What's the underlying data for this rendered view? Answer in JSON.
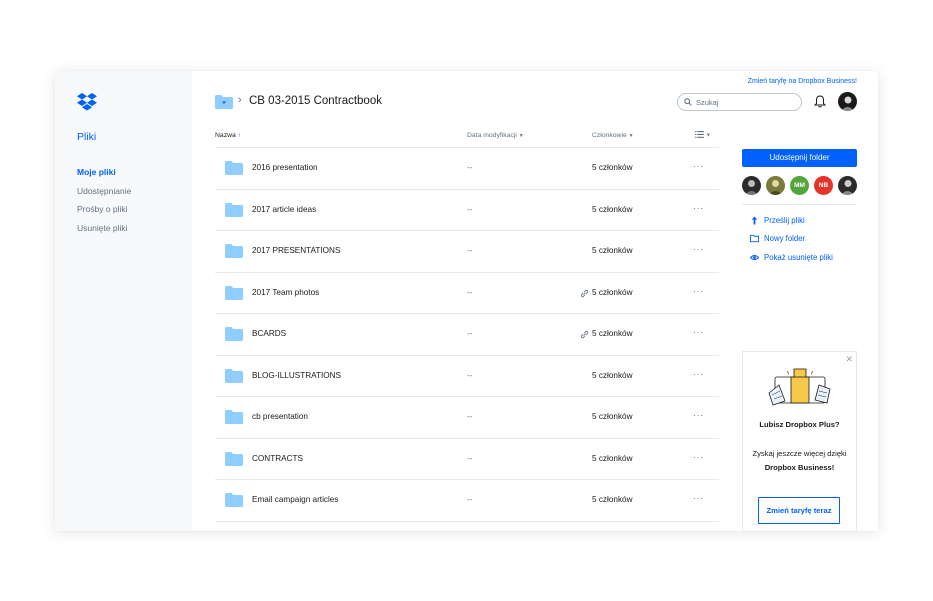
{
  "header": {
    "upgrade_link": "Zmień taryfę na Dropbox Business!",
    "title": "CB 03-2015 Contractbook",
    "search_placeholder": "Szukaj"
  },
  "sidebar": {
    "title": "Pliki",
    "items": [
      {
        "label": "Moje pliki",
        "active": true
      },
      {
        "label": "Udostępnianie"
      },
      {
        "label": "Prośby o pliki"
      },
      {
        "label": "Usunięte pliki"
      }
    ]
  },
  "table": {
    "columns": {
      "name": "Nazwa",
      "date": "Data modyfikacji",
      "members": "Członkowie"
    },
    "rows": [
      {
        "name": "2016 presentation",
        "date": "--",
        "members": "5 członków",
        "link": false
      },
      {
        "name": "2017 article ideas",
        "date": "--",
        "members": "5 członków",
        "link": false
      },
      {
        "name": "2017 PRESENTATIONS",
        "date": "--",
        "members": "5 członków",
        "link": false
      },
      {
        "name": "2017 Team photos",
        "date": "--",
        "members": "5 członków",
        "link": true
      },
      {
        "name": "BCARDS",
        "date": "--",
        "members": "5 członków",
        "link": true
      },
      {
        "name": "BLOG-ILLUSTRATIONS",
        "date": "--",
        "members": "5 członków",
        "link": false
      },
      {
        "name": "cb presentation",
        "date": "--",
        "members": "5 członków",
        "link": false
      },
      {
        "name": "CONTRACTS",
        "date": "--",
        "members": "5 członków",
        "link": false
      },
      {
        "name": "Email campaign articles",
        "date": "--",
        "members": "5 członków",
        "link": false
      }
    ]
  },
  "right_panel": {
    "share_button": "Udostępnij folder",
    "members": [
      {
        "initials": "",
        "color": "#2b2b2b"
      },
      {
        "initials": "",
        "color": "#7a7a3c"
      },
      {
        "initials": "MM",
        "color": "#54a63c"
      },
      {
        "initials": "NB",
        "color": "#e5332a"
      },
      {
        "initials": "",
        "color": "#2b2b2b"
      }
    ],
    "actions": [
      {
        "label": "Prześlij pliki",
        "icon": "upload-icon"
      },
      {
        "label": "Nowy folder",
        "icon": "new-folder-icon"
      },
      {
        "label": "Pokaż usunięte pliki",
        "icon": "eye-icon"
      }
    ]
  },
  "promo": {
    "title": "Lubisz Dropbox Plus?",
    "text_prefix": "Zyskaj jeszcze więcej dzięki",
    "text_bold": "Dropbox Business!",
    "button": "Zmień taryfę teraz"
  },
  "colors": {
    "accent": "#0061fe",
    "folder": "#90ceff",
    "text_secondary": "#637282"
  }
}
